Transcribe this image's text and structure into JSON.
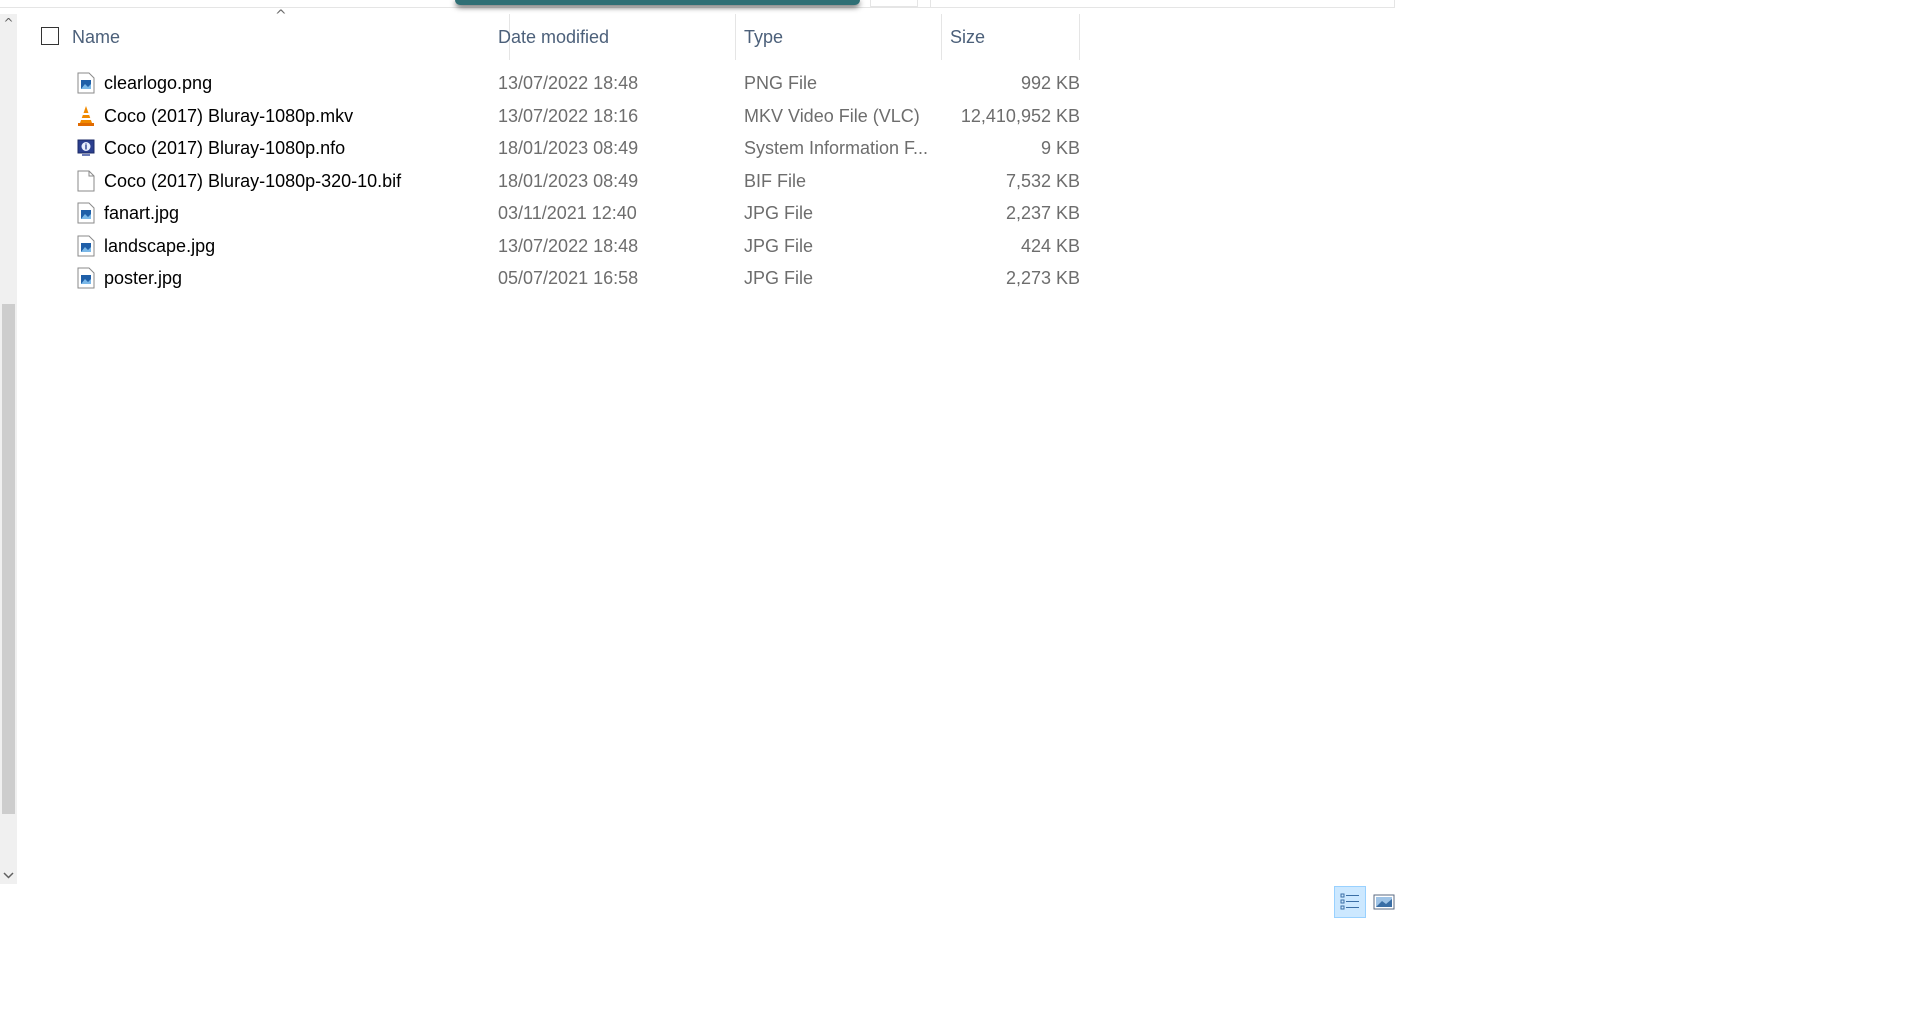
{
  "columns": {
    "name": "Name",
    "date": "Date modified",
    "type": "Type",
    "size": "Size"
  },
  "files": [
    {
      "name": "clearlogo.png",
      "date": "13/07/2022 18:48",
      "type": "PNG File",
      "size": "992 KB",
      "icon": "image-file-icon"
    },
    {
      "name": "Coco (2017) Bluray-1080p.mkv",
      "date": "13/07/2022 18:16",
      "type": "MKV Video File (VLC)",
      "size": "12,410,952 KB",
      "icon": "vlc-cone-icon"
    },
    {
      "name": "Coco (2017) Bluray-1080p.nfo",
      "date": "18/01/2023 08:49",
      "type": "System Information F...",
      "size": "9 KB",
      "icon": "system-info-icon"
    },
    {
      "name": "Coco (2017) Bluray-1080p-320-10.bif",
      "date": "18/01/2023 08:49",
      "type": "BIF File",
      "size": "7,532 KB",
      "icon": "blank-file-icon"
    },
    {
      "name": "fanart.jpg",
      "date": "03/11/2021 12:40",
      "type": "JPG File",
      "size": "2,237 KB",
      "icon": "image-file-icon"
    },
    {
      "name": "landscape.jpg",
      "date": "13/07/2022 18:48",
      "type": "JPG File",
      "size": "424 KB",
      "icon": "image-file-icon"
    },
    {
      "name": "poster.jpg",
      "date": "05/07/2021 16:58",
      "type": "JPG File",
      "size": "2,273 KB",
      "icon": "image-file-icon"
    }
  ],
  "colors": {
    "header_text": "#4c607a",
    "secondary_text": "#6d6d6d",
    "selected_view": "#cce8ff"
  }
}
